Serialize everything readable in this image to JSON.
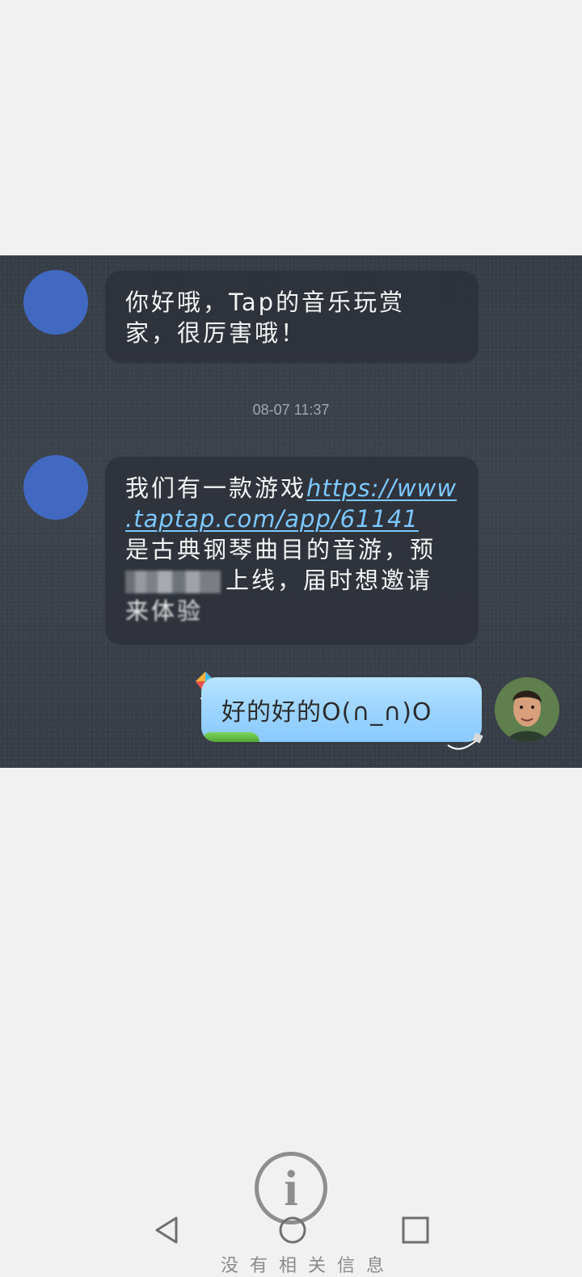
{
  "chat": {
    "msg1_lines": [
      "你好哦，Tap的音乐玩赏",
      "家，很厉害哦！"
    ],
    "timestamp": "08-07 11:37",
    "msg2": {
      "line1_prefix": "我们有一款游戏",
      "line1_link": "https://www",
      "line2_link": ".taptap.com/app/61141",
      "line3": "是古典钢琴曲目的音游，预",
      "line4_suffix": "上线，届时想邀请",
      "line5": "来体验"
    },
    "reply": "好的好的O(∩_∩)O"
  },
  "overlay": {
    "info_glyph": "i",
    "bottom_text": "没有相关信息"
  },
  "colors": {
    "chat_background": "#3a4048",
    "placeholder_avatar": "#4169c1",
    "reply_bubble": "#9ad3ff",
    "link": "#7cc8ff"
  }
}
